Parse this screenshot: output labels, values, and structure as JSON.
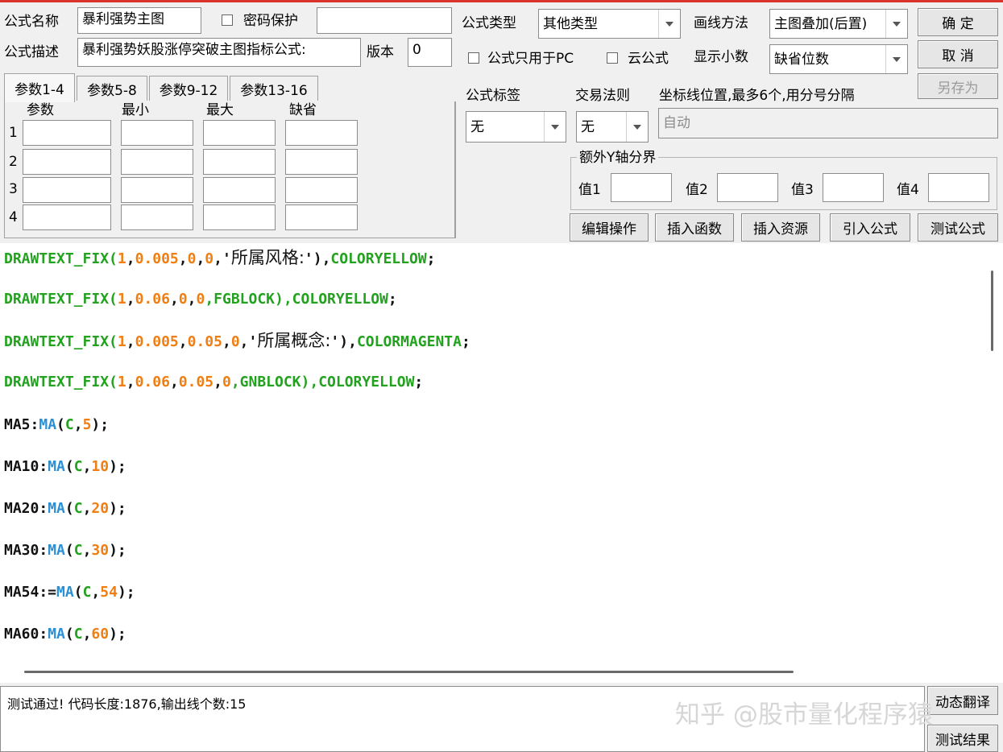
{
  "header": {
    "formula_name_label": "公式名称",
    "formula_name_value": "暴利强势主图",
    "password_label": "密码保护",
    "password_value": "",
    "formula_desc_label": "公式描述",
    "formula_desc_value": "暴利强势妖股涨停突破主图指标公式:",
    "version_label": "版本",
    "version_value": "0",
    "type_label": "公式类型",
    "type_value": "其他类型",
    "draw_method_label": "画线方法",
    "draw_method_value": "主图叠加(后置)",
    "pc_only_label": "公式只用于PC",
    "cloud_label": "云公式",
    "decimals_label": "显示小数",
    "decimals_value": "缺省位数"
  },
  "buttons": {
    "ok": "确 定",
    "cancel": "取 消",
    "save_as": "另存为",
    "edit_op": "编辑操作",
    "insert_func": "插入函数",
    "insert_res": "插入资源",
    "import_formula": "引入公式",
    "test_formula": "测试公式",
    "dynamic_translate": "动态翻译",
    "test_result": "测试结果"
  },
  "params": {
    "tabs": [
      "参数1-4",
      "参数5-8",
      "参数9-12",
      "参数13-16"
    ],
    "columns": [
      "参数",
      "最小",
      "最大",
      "缺省"
    ],
    "rows": [
      "1",
      "2",
      "3",
      "4"
    ]
  },
  "right_panel": {
    "tag_label": "公式标签",
    "tag_value": "无",
    "rule_label": "交易法则",
    "rule_value": "无",
    "axis_label": "坐标线位置,最多6个,用分号分隔",
    "axis_value": "自动",
    "extra_y_label": "额外Y轴分界",
    "value_labels": [
      "值1",
      "值2",
      "值3",
      "值4"
    ]
  },
  "code": {
    "line1": {
      "a": "DRAWTEXT_FIX(",
      "n1": "1",
      "c1": ",",
      "n2": "0.005",
      "c2": ",",
      "n3": "0",
      "c3": ",",
      "n4": "0",
      "c4": ",'",
      "cn": "所属风格:",
      "end": "'),",
      "color": "COLORYELLOW",
      "semi": ";"
    },
    "line2": {
      "a": "DRAWTEXT_FIX(",
      "n1": "1",
      "c1": ",",
      "n2": "0.06",
      "c2": ",",
      "n3": "0",
      "c3": ",",
      "n4": "0",
      "rest": ",FGBLOCK),COLORYELLOW",
      "semi": ";"
    },
    "line3": {
      "a": "DRAWTEXT_FIX(",
      "n1": "1",
      "c1": ",",
      "n2": "0.005",
      "c2": ",",
      "n3": "0.05",
      "c3": ",",
      "n4": "0",
      "c4": ",'",
      "cn": "所属概念:",
      "end": "'),",
      "color": "COLORMAGENTA",
      "semi": ";"
    },
    "line4": {
      "a": "DRAWTEXT_FIX(",
      "n1": "1",
      "c1": ",",
      "n2": "0.06",
      "c2": ",",
      "n3": "0.05",
      "c3": ",",
      "n4": "0",
      "rest": ",GNBLOCK),COLORYELLOW",
      "semi": ";"
    },
    "ma_lines": [
      {
        "name": "MA5:",
        "func": "MA",
        "open": "(",
        "arg": "C",
        "comma": ",",
        "n": "5",
        "close": ");"
      },
      {
        "name": "MA10:",
        "func": "MA",
        "open": "(",
        "arg": "C",
        "comma": ",",
        "n": "10",
        "close": ");"
      },
      {
        "name": "MA20:",
        "func": "MA",
        "open": "(",
        "arg": "C",
        "comma": ",",
        "n": "20",
        "close": ");"
      },
      {
        "name": "MA30:",
        "func": "MA",
        "open": "(",
        "arg": "C",
        "comma": ",",
        "n": "30",
        "close": ");"
      },
      {
        "name": "MA54:=",
        "func": "MA",
        "open": "(",
        "arg": "C",
        "comma": ",",
        "n": "54",
        "close": ");"
      },
      {
        "name": "MA60:",
        "func": "MA",
        "open": "(",
        "arg": "C",
        "comma": ",",
        "n": "60",
        "close": ");"
      }
    ]
  },
  "output": {
    "message": "测试通过! 代码长度:1876,输出线个数:15"
  },
  "watermark": "知乎 @股市量化程序猿",
  "colors": {
    "green": "#22a21e",
    "orange": "#f07e13",
    "blue": "#2b8fd4",
    "accent_red": "#d9342b"
  }
}
